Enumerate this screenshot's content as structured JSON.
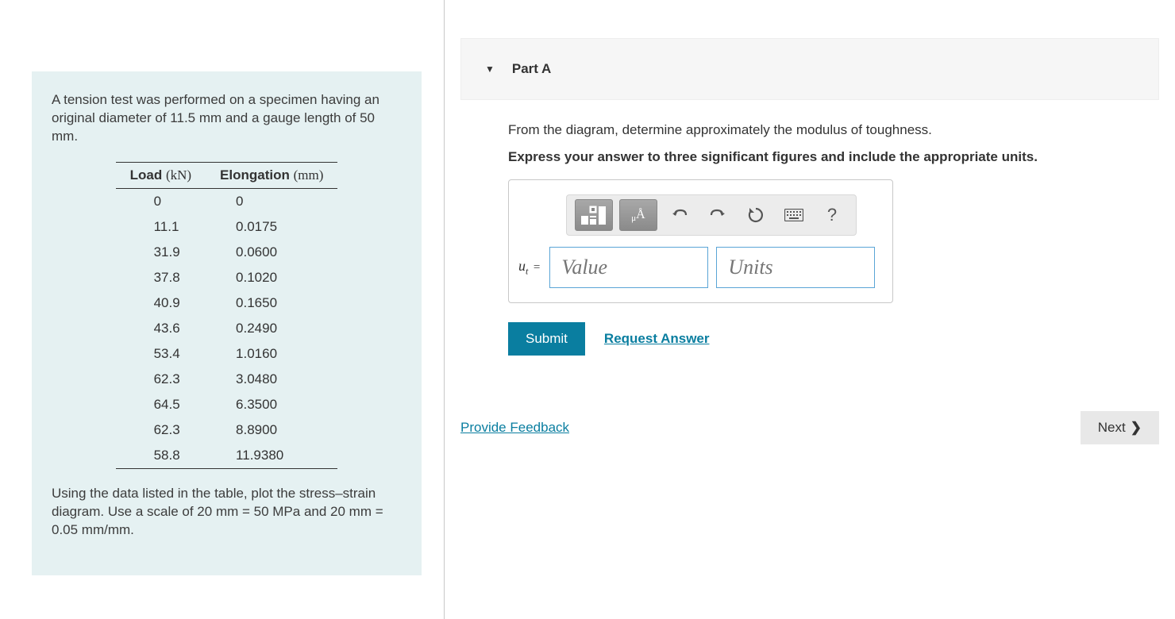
{
  "problem": {
    "intro": "A tension test was performed on a specimen having an original diameter of 11.5 mm and a gauge length of 50 mm.",
    "table": {
      "head_load": "Load",
      "head_load_unit": "(kN)",
      "head_elong": "Elongation",
      "head_elong_unit": "(mm)",
      "rows": [
        {
          "load": "0",
          "elong": "0"
        },
        {
          "load": "11.1",
          "elong": "0.0175"
        },
        {
          "load": "31.9",
          "elong": "0.0600"
        },
        {
          "load": "37.8",
          "elong": "0.1020"
        },
        {
          "load": "40.9",
          "elong": "0.1650"
        },
        {
          "load": "43.6",
          "elong": "0.2490"
        },
        {
          "load": "53.4",
          "elong": "1.0160"
        },
        {
          "load": "62.3",
          "elong": "3.0480"
        },
        {
          "load": "64.5",
          "elong": "6.3500"
        },
        {
          "load": "62.3",
          "elong": "8.8900"
        },
        {
          "load": "58.8",
          "elong": "11.9380"
        }
      ]
    },
    "instr": "Using the data listed in the table, plot the stress–strain diagram. Use a scale of 20 mm = 50 MPa and 20 mm = 0.05 mm/mm."
  },
  "part": {
    "title": "Part A",
    "question": "From the diagram, determine approximately the modulus of toughness.",
    "instruction": "Express your answer to three significant figures and include the appropriate units.",
    "variable": "u",
    "variable_sub": "t",
    "eq": "=",
    "value_placeholder": "Value",
    "units_placeholder": "Units",
    "toolbar": {
      "template_label": "□",
      "units_label": "μÅ",
      "help_label": "?"
    },
    "submit": "Submit",
    "request": "Request Answer"
  },
  "footer": {
    "feedback": "Provide Feedback",
    "next": "Next"
  },
  "chart_data": {
    "type": "table",
    "title": "Tension test data",
    "columns": [
      "Load (kN)",
      "Elongation (mm)"
    ],
    "rows": [
      [
        0,
        0
      ],
      [
        11.1,
        0.0175
      ],
      [
        31.9,
        0.06
      ],
      [
        37.8,
        0.102
      ],
      [
        40.9,
        0.165
      ],
      [
        43.6,
        0.249
      ],
      [
        53.4,
        1.016
      ],
      [
        62.3,
        3.048
      ],
      [
        64.5,
        6.35
      ],
      [
        62.3,
        8.89
      ],
      [
        58.8,
        11.938
      ]
    ]
  }
}
